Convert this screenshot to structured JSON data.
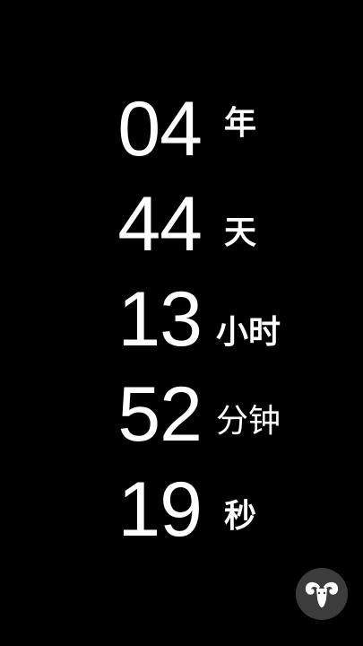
{
  "countdown": {
    "rows": [
      {
        "value": "04",
        "unit": "年"
      },
      {
        "value": "44",
        "unit": "天"
      },
      {
        "value": "13",
        "unit": "小时"
      },
      {
        "value": "52",
        "unit": "分钟"
      },
      {
        "value": "19",
        "unit": "秒"
      }
    ]
  },
  "fab": {
    "icon": "ram-head-icon",
    "background": "#3c3c3c",
    "icon_color": "#ffffff"
  },
  "colors": {
    "background": "#000000",
    "text": "#ffffff"
  }
}
